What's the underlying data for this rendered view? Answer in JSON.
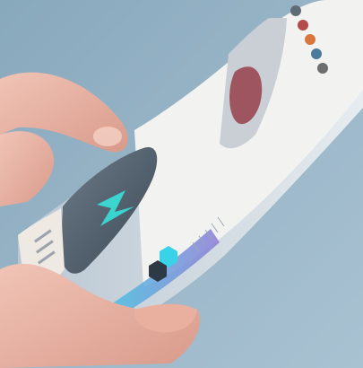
{
  "photo": {
    "subject": "foldable-phone-in-hand",
    "palette": {
      "background": "#9bb7c9",
      "skin": "#e7b4a6",
      "screen_dark": "#4a5a68",
      "screen_white": "#f2f3f1",
      "accent_cyan": "#3ad2e6",
      "accent_purple": "#8b7cd6",
      "frame_silver": "#cfd7de"
    }
  }
}
